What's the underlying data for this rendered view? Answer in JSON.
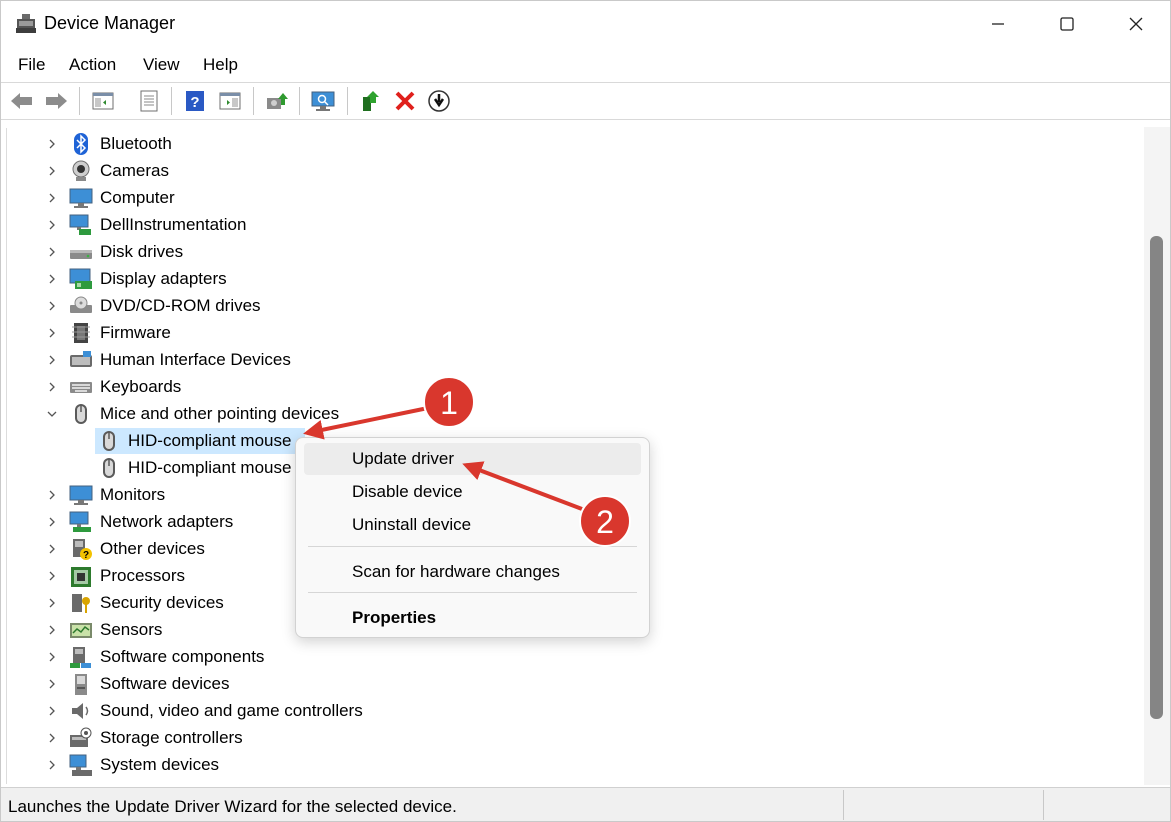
{
  "window": {
    "title": "Device Manager"
  },
  "menu": {
    "items": [
      "File",
      "Action",
      "View",
      "Help"
    ]
  },
  "toolbar": {
    "icons": [
      "back-arrow-icon",
      "forward-arrow-icon",
      "show-hide-tree-icon",
      "properties-icon",
      "help-icon",
      "view-icon",
      "update-driver-icon",
      "scan-monitor-icon",
      "enable-device-icon",
      "uninstall-x-icon",
      "disable-device-icon"
    ]
  },
  "tree": {
    "categories": [
      {
        "label": "Bluetooth",
        "icon": "bluetooth-icon"
      },
      {
        "label": "Cameras",
        "icon": "camera-icon"
      },
      {
        "label": "Computer",
        "icon": "computer-icon"
      },
      {
        "label": "DellInstrumentation",
        "icon": "monitor-network-icon"
      },
      {
        "label": "Disk drives",
        "icon": "disk-drive-icon"
      },
      {
        "label": "Display adapters",
        "icon": "display-adapter-icon"
      },
      {
        "label": "DVD/CD-ROM drives",
        "icon": "dvd-drive-icon"
      },
      {
        "label": "Firmware",
        "icon": "firmware-chip-icon"
      },
      {
        "label": "Human Interface Devices",
        "icon": "hid-icon"
      },
      {
        "label": "Keyboards",
        "icon": "keyboard-icon"
      },
      {
        "label": "Mice and other pointing devices",
        "icon": "mouse-icon"
      }
    ],
    "mice_children": [
      {
        "label": "HID-compliant mouse",
        "icon": "mouse-icon"
      },
      {
        "label": "HID-compliant mouse",
        "icon": "mouse-icon"
      }
    ],
    "categories_after": [
      {
        "label": "Monitors",
        "icon": "monitor-icon"
      },
      {
        "label": "Network adapters",
        "icon": "network-adapter-icon"
      },
      {
        "label": "Other devices",
        "icon": "other-devices-icon"
      },
      {
        "label": "Processors",
        "icon": "processor-icon"
      },
      {
        "label": "Security devices",
        "icon": "security-device-icon"
      },
      {
        "label": "Sensors",
        "icon": "sensor-icon"
      },
      {
        "label": "Software components",
        "icon": "software-component-icon"
      },
      {
        "label": "Software devices",
        "icon": "software-device-icon"
      },
      {
        "label": "Sound, video and game controllers",
        "icon": "speaker-icon"
      },
      {
        "label": "Storage controllers",
        "icon": "storage-controller-icon"
      },
      {
        "label": "System devices",
        "icon": "system-device-icon"
      }
    ]
  },
  "context_menu": {
    "update": "Update driver",
    "disable": "Disable device",
    "uninstall": "Uninstall device",
    "scan": "Scan for hardware changes",
    "properties": "Properties"
  },
  "annotations": {
    "marker1": "1",
    "marker2": "2",
    "color": "#d9372d"
  },
  "statusbar": {
    "text": "Launches the Update Driver Wizard for the selected device."
  },
  "colors": {
    "selection": "#cce8ff",
    "scroll_thumb": "#858585",
    "accent": "#0078d4"
  }
}
